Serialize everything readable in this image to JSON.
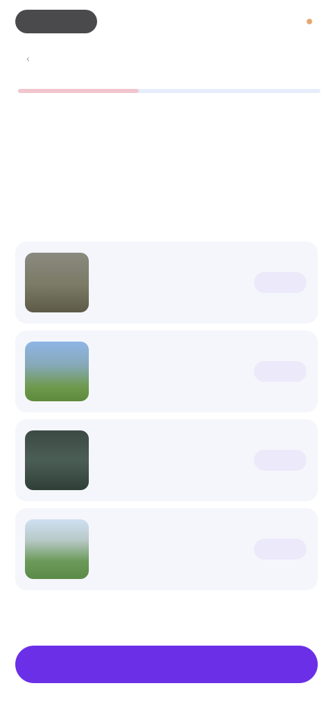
{
  "header": {
    "logo_text": "",
    "link_text": ""
  },
  "progress": {
    "fraction": 0.4
  },
  "section": {
    "heading": "",
    "description": ""
  },
  "cards": [
    {
      "title": "",
      "button_label": ""
    },
    {
      "title": "",
      "button_label": ""
    },
    {
      "title": "",
      "button_label": ""
    },
    {
      "title": "",
      "button_label": ""
    }
  ],
  "more_link": "",
  "cta_label": "",
  "colors": {
    "accent": "#6a2fe7",
    "card_bg": "#f5f6fb",
    "button_tint": "#ece9fb"
  }
}
